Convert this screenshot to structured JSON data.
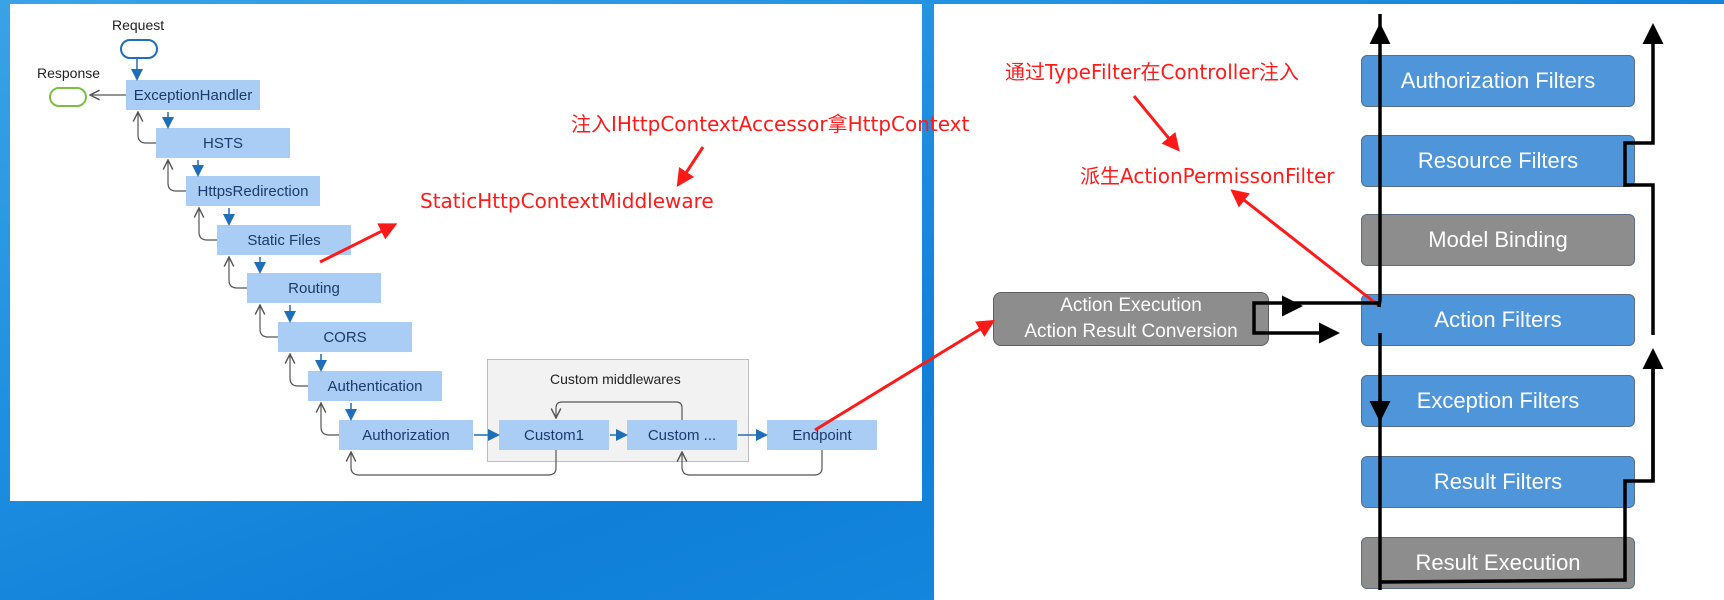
{
  "left_diagram": {
    "request_label": "Request",
    "response_label": "Response",
    "middlewares": [
      "ExceptionHandler",
      "HSTS",
      "HttpsRedirection",
      "Static Files",
      "Routing",
      "CORS",
      "Authentication",
      "Authorization"
    ],
    "custom_group_label": "Custom middlewares",
    "custom1": "Custom1",
    "custom2": "Custom ...",
    "endpoint": "Endpoint"
  },
  "annotations": {
    "inject_accessor": "注入IHttpContextAccessor拿HttpContext",
    "static_middleware": "StaticHttpContextMiddleware",
    "typefilter_inject": "通过TypeFilter在Controller注入",
    "derived_filter": "派生ActionPermissonFilter"
  },
  "filter_pipeline": {
    "filters": [
      "Authorization Filters",
      "Resource Filters",
      "Model Binding",
      "Action Filters",
      "Exception Filters",
      "Result Filters",
      "Result Execution"
    ],
    "action_execution_line1": "Action Execution",
    "action_execution_line2": "Action Result Conversion"
  },
  "colors": {
    "middleware_fill": "#aacdf5",
    "filter_blue": "#4e95d9",
    "filter_gray": "#8d8d8d",
    "annotation_red": "#ff1a1a",
    "flow_arrow": "#1f6fb8"
  }
}
